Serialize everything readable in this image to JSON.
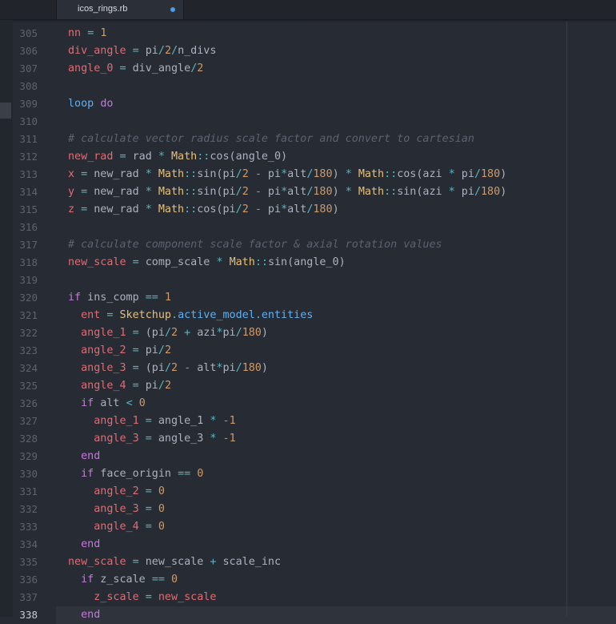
{
  "tab": {
    "title": "icos_rings.rb",
    "modified": true
  },
  "colors": {
    "background": "#272b33",
    "keyword": "#c678dd",
    "variable": "#e06c75",
    "number": "#d19a66",
    "operator": "#56b6c2",
    "class": "#e5c07b",
    "method": "#61afef",
    "comment": "#5c6370",
    "text": "#abb2bf",
    "modified_dot": "#4d9ce9"
  },
  "editor": {
    "current_line": 338,
    "lines": [
      {
        "num": "305",
        "tokens": [
          [
            "v",
            "nn"
          ],
          [
            "t",
            " "
          ],
          [
            "o",
            "="
          ],
          [
            "t",
            " "
          ],
          [
            "n",
            "1"
          ]
        ]
      },
      {
        "num": "306",
        "tokens": [
          [
            "v",
            "div_angle"
          ],
          [
            "t",
            " "
          ],
          [
            "o",
            "="
          ],
          [
            "t",
            " pi"
          ],
          [
            "o",
            "/"
          ],
          [
            "n",
            "2"
          ],
          [
            "o",
            "/"
          ],
          [
            "t",
            "n_divs"
          ]
        ]
      },
      {
        "num": "307",
        "tokens": [
          [
            "v",
            "angle_0"
          ],
          [
            "t",
            " "
          ],
          [
            "o",
            "="
          ],
          [
            "t",
            " div_angle"
          ],
          [
            "o",
            "/"
          ],
          [
            "n",
            "2"
          ]
        ]
      },
      {
        "num": "308",
        "tokens": []
      },
      {
        "num": "309",
        "tokens": [
          [
            "m",
            "loop"
          ],
          [
            "t",
            " "
          ],
          [
            "k",
            "do"
          ]
        ]
      },
      {
        "num": "310",
        "tokens": []
      },
      {
        "num": "311",
        "tokens": [
          [
            "c",
            "# calculate vector radius scale factor and convert to cartesian"
          ]
        ]
      },
      {
        "num": "312",
        "tokens": [
          [
            "v",
            "new_rad"
          ],
          [
            "t",
            " "
          ],
          [
            "o",
            "="
          ],
          [
            "t",
            " rad "
          ],
          [
            "o",
            "*"
          ],
          [
            "t",
            " "
          ],
          [
            "cl",
            "Math"
          ],
          [
            "o",
            "::"
          ],
          [
            "t",
            "cos(angle_0)"
          ]
        ]
      },
      {
        "num": "313",
        "tokens": [
          [
            "v",
            "x"
          ],
          [
            "t",
            " "
          ],
          [
            "o",
            "="
          ],
          [
            "t",
            " new_rad "
          ],
          [
            "o",
            "*"
          ],
          [
            "t",
            " "
          ],
          [
            "cl",
            "Math"
          ],
          [
            "o",
            "::"
          ],
          [
            "t",
            "sin(pi"
          ],
          [
            "o",
            "/"
          ],
          [
            "n",
            "2"
          ],
          [
            "t",
            " "
          ],
          [
            "o",
            "-"
          ],
          [
            "t",
            " pi"
          ],
          [
            "o",
            "*"
          ],
          [
            "t",
            "alt"
          ],
          [
            "o",
            "/"
          ],
          [
            "n",
            "180"
          ],
          [
            "t",
            ") "
          ],
          [
            "o",
            "*"
          ],
          [
            "t",
            " "
          ],
          [
            "cl",
            "Math"
          ],
          [
            "o",
            "::"
          ],
          [
            "t",
            "cos(azi "
          ],
          [
            "o",
            "*"
          ],
          [
            "t",
            " pi"
          ],
          [
            "o",
            "/"
          ],
          [
            "n",
            "180"
          ],
          [
            "t",
            ")"
          ]
        ]
      },
      {
        "num": "314",
        "tokens": [
          [
            "v",
            "y"
          ],
          [
            "t",
            " "
          ],
          [
            "o",
            "="
          ],
          [
            "t",
            " new_rad "
          ],
          [
            "o",
            "*"
          ],
          [
            "t",
            " "
          ],
          [
            "cl",
            "Math"
          ],
          [
            "o",
            "::"
          ],
          [
            "t",
            "sin(pi"
          ],
          [
            "o",
            "/"
          ],
          [
            "n",
            "2"
          ],
          [
            "t",
            " "
          ],
          [
            "o",
            "-"
          ],
          [
            "t",
            " pi"
          ],
          [
            "o",
            "*"
          ],
          [
            "t",
            "alt"
          ],
          [
            "o",
            "/"
          ],
          [
            "n",
            "180"
          ],
          [
            "t",
            ") "
          ],
          [
            "o",
            "*"
          ],
          [
            "t",
            " "
          ],
          [
            "cl",
            "Math"
          ],
          [
            "o",
            "::"
          ],
          [
            "t",
            "sin(azi "
          ],
          [
            "o",
            "*"
          ],
          [
            "t",
            " pi"
          ],
          [
            "o",
            "/"
          ],
          [
            "n",
            "180"
          ],
          [
            "t",
            ")"
          ]
        ]
      },
      {
        "num": "315",
        "tokens": [
          [
            "v",
            "z"
          ],
          [
            "t",
            " "
          ],
          [
            "o",
            "="
          ],
          [
            "t",
            " new_rad "
          ],
          [
            "o",
            "*"
          ],
          [
            "t",
            " "
          ],
          [
            "cl",
            "Math"
          ],
          [
            "o",
            "::"
          ],
          [
            "t",
            "cos(pi"
          ],
          [
            "o",
            "/"
          ],
          [
            "n",
            "2"
          ],
          [
            "t",
            " "
          ],
          [
            "o",
            "-"
          ],
          [
            "t",
            " pi"
          ],
          [
            "o",
            "*"
          ],
          [
            "t",
            "alt"
          ],
          [
            "o",
            "/"
          ],
          [
            "n",
            "180"
          ],
          [
            "t",
            ")"
          ]
        ]
      },
      {
        "num": "316",
        "tokens": []
      },
      {
        "num": "317",
        "tokens": [
          [
            "c",
            "# calculate component scale factor & axial rotation values"
          ]
        ]
      },
      {
        "num": "318",
        "tokens": [
          [
            "v",
            "new_scale"
          ],
          [
            "t",
            " "
          ],
          [
            "o",
            "="
          ],
          [
            "t",
            " comp_scale "
          ],
          [
            "o",
            "*"
          ],
          [
            "t",
            " "
          ],
          [
            "cl",
            "Math"
          ],
          [
            "o",
            "::"
          ],
          [
            "t",
            "sin(angle_0)"
          ]
        ]
      },
      {
        "num": "319",
        "tokens": []
      },
      {
        "num": "320",
        "tokens": [
          [
            "k",
            "if"
          ],
          [
            "t",
            " ins_comp "
          ],
          [
            "o",
            "=="
          ],
          [
            "t",
            " "
          ],
          [
            "n",
            "1"
          ]
        ]
      },
      {
        "num": "321",
        "tokens": [
          [
            "t",
            "  "
          ],
          [
            "v",
            "ent"
          ],
          [
            "t",
            " "
          ],
          [
            "o",
            "="
          ],
          [
            "t",
            " "
          ],
          [
            "cl",
            "Sketchup"
          ],
          [
            "o",
            "."
          ],
          [
            "m",
            "active_model"
          ],
          [
            "o",
            "."
          ],
          [
            "m",
            "entities"
          ]
        ]
      },
      {
        "num": "322",
        "tokens": [
          [
            "t",
            "  "
          ],
          [
            "v",
            "angle_1"
          ],
          [
            "t",
            " "
          ],
          [
            "o",
            "="
          ],
          [
            "t",
            " (pi"
          ],
          [
            "o",
            "/"
          ],
          [
            "n",
            "2"
          ],
          [
            "t",
            " "
          ],
          [
            "o",
            "+"
          ],
          [
            "t",
            " azi"
          ],
          [
            "o",
            "*"
          ],
          [
            "t",
            "pi"
          ],
          [
            "o",
            "/"
          ],
          [
            "n",
            "180"
          ],
          [
            "t",
            ")"
          ]
        ]
      },
      {
        "num": "323",
        "tokens": [
          [
            "t",
            "  "
          ],
          [
            "v",
            "angle_2"
          ],
          [
            "t",
            " "
          ],
          [
            "o",
            "="
          ],
          [
            "t",
            " pi"
          ],
          [
            "o",
            "/"
          ],
          [
            "n",
            "2"
          ]
        ]
      },
      {
        "num": "324",
        "tokens": [
          [
            "t",
            "  "
          ],
          [
            "v",
            "angle_3"
          ],
          [
            "t",
            " "
          ],
          [
            "o",
            "="
          ],
          [
            "t",
            " (pi"
          ],
          [
            "o",
            "/"
          ],
          [
            "n",
            "2"
          ],
          [
            "t",
            " "
          ],
          [
            "o",
            "-"
          ],
          [
            "t",
            " alt"
          ],
          [
            "o",
            "*"
          ],
          [
            "t",
            "pi"
          ],
          [
            "o",
            "/"
          ],
          [
            "n",
            "180"
          ],
          [
            "t",
            ")"
          ]
        ]
      },
      {
        "num": "325",
        "tokens": [
          [
            "t",
            "  "
          ],
          [
            "v",
            "angle_4"
          ],
          [
            "t",
            " "
          ],
          [
            "o",
            "="
          ],
          [
            "t",
            " pi"
          ],
          [
            "o",
            "/"
          ],
          [
            "n",
            "2"
          ]
        ]
      },
      {
        "num": "326",
        "tokens": [
          [
            "t",
            "  "
          ],
          [
            "k",
            "if"
          ],
          [
            "t",
            " alt "
          ],
          [
            "o",
            "<"
          ],
          [
            "t",
            " "
          ],
          [
            "n",
            "0"
          ]
        ]
      },
      {
        "num": "327",
        "tokens": [
          [
            "t",
            "    "
          ],
          [
            "v",
            "angle_1"
          ],
          [
            "t",
            " "
          ],
          [
            "o",
            "="
          ],
          [
            "t",
            " angle_1 "
          ],
          [
            "o",
            "*"
          ],
          [
            "t",
            " "
          ],
          [
            "o",
            "-"
          ],
          [
            "n",
            "1"
          ]
        ]
      },
      {
        "num": "328",
        "tokens": [
          [
            "t",
            "    "
          ],
          [
            "v",
            "angle_3"
          ],
          [
            "t",
            " "
          ],
          [
            "o",
            "="
          ],
          [
            "t",
            " angle_3 "
          ],
          [
            "o",
            "*"
          ],
          [
            "t",
            " "
          ],
          [
            "o",
            "-"
          ],
          [
            "n",
            "1"
          ]
        ]
      },
      {
        "num": "329",
        "tokens": [
          [
            "t",
            "  "
          ],
          [
            "k",
            "end"
          ]
        ]
      },
      {
        "num": "330",
        "tokens": [
          [
            "t",
            "  "
          ],
          [
            "k",
            "if"
          ],
          [
            "t",
            " face_origin "
          ],
          [
            "o",
            "=="
          ],
          [
            "t",
            " "
          ],
          [
            "n",
            "0"
          ]
        ]
      },
      {
        "num": "331",
        "tokens": [
          [
            "t",
            "    "
          ],
          [
            "v",
            "angle_2"
          ],
          [
            "t",
            " "
          ],
          [
            "o",
            "="
          ],
          [
            "t",
            " "
          ],
          [
            "n",
            "0"
          ]
        ]
      },
      {
        "num": "332",
        "tokens": [
          [
            "t",
            "    "
          ],
          [
            "v",
            "angle_3"
          ],
          [
            "t",
            " "
          ],
          [
            "o",
            "="
          ],
          [
            "t",
            " "
          ],
          [
            "n",
            "0"
          ]
        ]
      },
      {
        "num": "333",
        "tokens": [
          [
            "t",
            "    "
          ],
          [
            "v",
            "angle_4"
          ],
          [
            "t",
            " "
          ],
          [
            "o",
            "="
          ],
          [
            "t",
            " "
          ],
          [
            "n",
            "0"
          ]
        ]
      },
      {
        "num": "334",
        "tokens": [
          [
            "t",
            "  "
          ],
          [
            "k",
            "end"
          ]
        ]
      },
      {
        "num": "335",
        "tokens": [
          [
            "v",
            "new_scale"
          ],
          [
            "t",
            " "
          ],
          [
            "o",
            "="
          ],
          [
            "t",
            " new_scale "
          ],
          [
            "o",
            "+"
          ],
          [
            "t",
            " scale_inc"
          ]
        ]
      },
      {
        "num": "336",
        "tokens": [
          [
            "t",
            "  "
          ],
          [
            "k",
            "if"
          ],
          [
            "t",
            " z_scale "
          ],
          [
            "o",
            "=="
          ],
          [
            "t",
            " "
          ],
          [
            "n",
            "0"
          ]
        ]
      },
      {
        "num": "337",
        "tokens": [
          [
            "t",
            "    "
          ],
          [
            "v",
            "z_scale"
          ],
          [
            "t",
            " "
          ],
          [
            "o",
            "="
          ],
          [
            "t",
            " "
          ],
          [
            "v",
            "new_scale"
          ]
        ]
      },
      {
        "num": "338",
        "tokens": [
          [
            "t",
            "  "
          ],
          [
            "k",
            "end"
          ]
        ]
      }
    ]
  }
}
